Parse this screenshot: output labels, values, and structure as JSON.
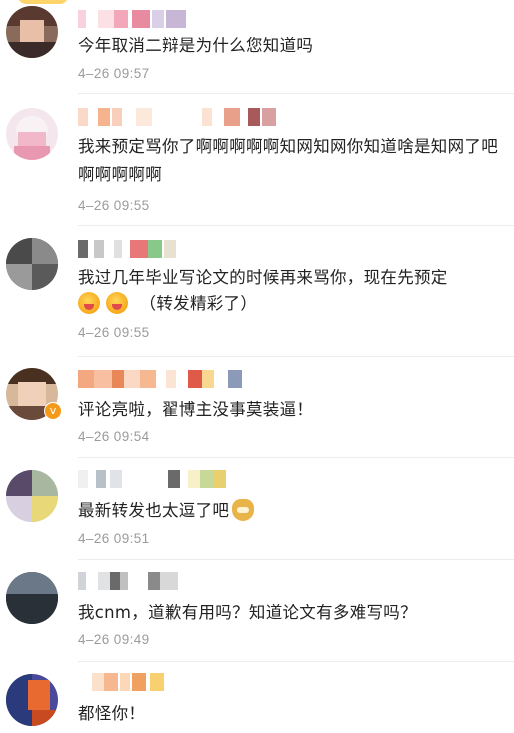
{
  "comments": [
    {
      "username_hidden": "pixelated",
      "text": "今年取消二辩是为什么您知道吗",
      "time": "4–26 09:57"
    },
    {
      "username_hidden": "pixelated",
      "text": "我来预定骂你了啊啊啊啊啊知网知网你知道啥是知网了吧啊啊啊啊啊",
      "time": "4–26 09:55"
    },
    {
      "username_hidden": "pixelated",
      "text": "我过几年毕业写论文的时候再来骂你，现在先预定",
      "emoji_line": "（转发精彩了）",
      "emojis": [
        "drool-emoji",
        "drool-emoji"
      ],
      "time": "4–26 09:55"
    },
    {
      "username_hidden": "pixelated",
      "verified": "v",
      "text": "评论亮啦，翟博主没事莫装逼！",
      "time": "4–26 09:54"
    },
    {
      "username_hidden": "pixelated",
      "text": "最新转发也太逗了吧",
      "emojis": [
        "doge-emoji"
      ],
      "time": "4–26 09:51"
    },
    {
      "username_hidden": "pixelated",
      "text": "我cnm，道歉有用吗？知道论文有多难写吗？",
      "time": "4–26 09:49"
    },
    {
      "username_hidden": "pixelated",
      "text": "都怪你！"
    }
  ],
  "colors": {
    "time": "#9b9b9b",
    "text": "#222222",
    "divider": "#ececec",
    "verified": "#f49a1b"
  }
}
